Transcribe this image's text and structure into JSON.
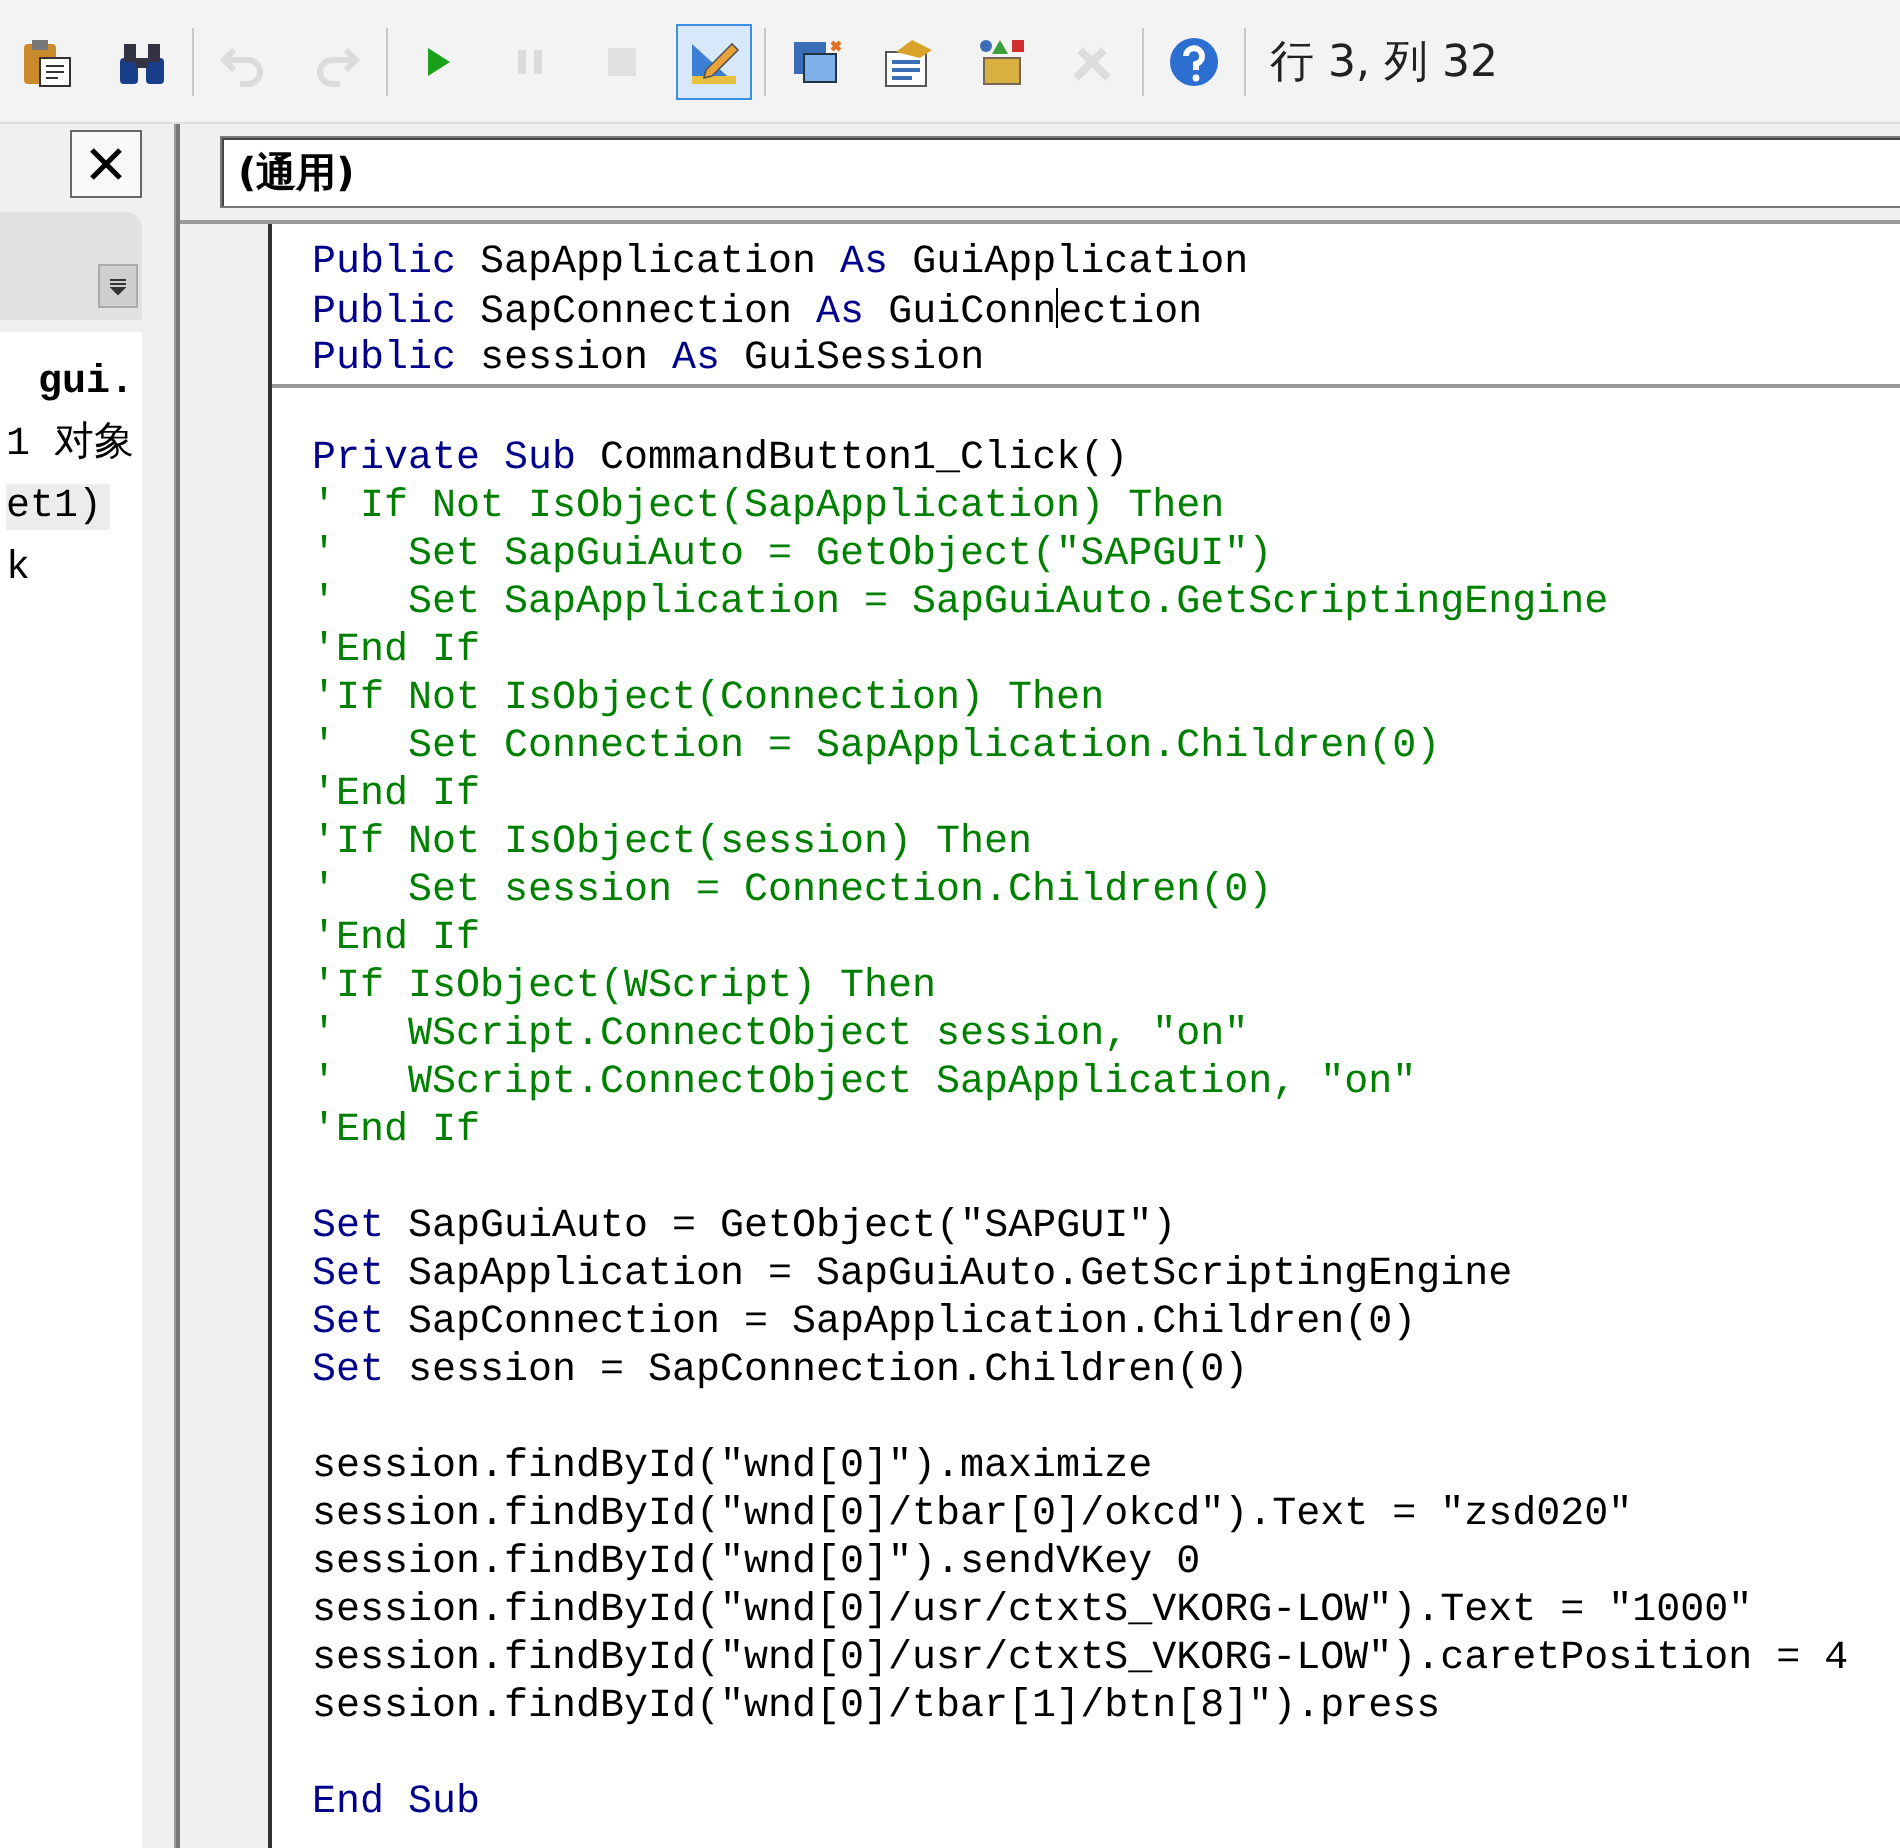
{
  "toolbar": {
    "groups": [
      [
        {
          "disabled": false,
          "selected": false
        },
        {
          "disabled": false,
          "selected": false
        }
      ],
      [
        {
          "disabled": true,
          "selected": false
        },
        {
          "disabled": true,
          "selected": false
        }
      ],
      [
        {
          "disabled": false,
          "selected": false
        },
        {
          "disabled": true,
          "selected": false
        },
        {
          "disabled": true,
          "selected": false
        },
        {
          "disabled": false,
          "selected": true
        }
      ],
      [
        {
          "disabled": false,
          "selected": false
        },
        {
          "disabled": false,
          "selected": false
        },
        {
          "disabled": false,
          "selected": false
        },
        {
          "disabled": true,
          "selected": false
        }
      ],
      [
        {
          "disabled": false,
          "selected": false
        }
      ]
    ],
    "position": "行 3, 列 32"
  },
  "side_panel": {
    "items": [
      {
        "text": "gui.",
        "kind": "header",
        "selected": false
      },
      {
        "text": "1 对象",
        "kind": "item",
        "selected": false
      },
      {
        "text": "et1)",
        "kind": "item",
        "selected": true
      },
      {
        "text": "k",
        "kind": "item",
        "selected": false
      }
    ]
  },
  "editor": {
    "object_combo": "(通用)",
    "sections": [
      {
        "blocks": [
          [
            [
              {
                "kind": "keyword",
                "text": "Public "
              },
              {
                "kind": "plain",
                "text": "SapApplication "
              },
              {
                "kind": "keyword",
                "text": "As "
              },
              {
                "kind": "plain",
                "text": "GuiApplication"
              }
            ],
            [
              {
                "kind": "keyword",
                "text": "Public "
              },
              {
                "kind": "plain",
                "text": "SapConnection "
              },
              {
                "kind": "keyword",
                "text": "As "
              },
              {
                "kind": "plain",
                "text": "GuiConn"
              },
              {
                "kind": "caret"
              },
              {
                "kind": "plain",
                "text": "ection"
              }
            ],
            [
              {
                "kind": "keyword",
                "text": "Public "
              },
              {
                "kind": "plain",
                "text": "session "
              },
              {
                "kind": "keyword",
                "text": "As "
              },
              {
                "kind": "plain",
                "text": "GuiSession"
              }
            ]
          ]
        ]
      },
      {
        "blocks": [
          [
            [
              {
                "kind": "keyword",
                "text": "Private Sub "
              },
              {
                "kind": "plain",
                "text": "CommandButton1_Click()"
              }
            ],
            [
              {
                "kind": "comment",
                "text": "' If Not IsObject(SapApplication) Then"
              }
            ],
            [
              {
                "kind": "comment",
                "text": "'   Set SapGuiAuto = GetObject(\"SAPGUI\")"
              }
            ],
            [
              {
                "kind": "comment",
                "text": "'   Set SapApplication = SapGuiAuto.GetScriptingEngine"
              }
            ],
            [
              {
                "kind": "comment",
                "text": "'End If"
              }
            ],
            [
              {
                "kind": "comment",
                "text": "'If Not IsObject(Connection) Then"
              }
            ],
            [
              {
                "kind": "comment",
                "text": "'   Set Connection = SapApplication.Children(0)"
              }
            ],
            [
              {
                "kind": "comment",
                "text": "'End If"
              }
            ],
            [
              {
                "kind": "comment",
                "text": "'If Not IsObject(session) Then"
              }
            ],
            [
              {
                "kind": "comment",
                "text": "'   Set session = Connection.Children(0)"
              }
            ],
            [
              {
                "kind": "comment",
                "text": "'End If"
              }
            ],
            [
              {
                "kind": "comment",
                "text": "'If IsObject(WScript) Then"
              }
            ],
            [
              {
                "kind": "comment",
                "text": "'   WScript.ConnectObject session, \"on\""
              }
            ],
            [
              {
                "kind": "comment",
                "text": "'   WScript.ConnectObject SapApplication, \"on\""
              }
            ],
            [
              {
                "kind": "comment",
                "text": "'End If"
              }
            ]
          ],
          [
            [
              {
                "kind": "keyword",
                "text": "Set "
              },
              {
                "kind": "plain",
                "text": "SapGuiAuto = GetObject(\"SAPGUI\")"
              }
            ],
            [
              {
                "kind": "keyword",
                "text": "Set "
              },
              {
                "kind": "plain",
                "text": "SapApplication = SapGuiAuto.GetScriptingEngine"
              }
            ],
            [
              {
                "kind": "keyword",
                "text": "Set "
              },
              {
                "kind": "plain",
                "text": "SapConnection = SapApplication.Children(0)"
              }
            ],
            [
              {
                "kind": "keyword",
                "text": "Set "
              },
              {
                "kind": "plain",
                "text": "session = SapConnection.Children(0)"
              }
            ]
          ],
          [
            [
              {
                "kind": "plain",
                "text": "session.findById(\"wnd[0]\").maximize"
              }
            ],
            [
              {
                "kind": "plain",
                "text": "session.findById(\"wnd[0]/tbar[0]/okcd\").Text = \"zsd020\""
              }
            ],
            [
              {
                "kind": "plain",
                "text": "session.findById(\"wnd[0]\").sendVKey 0"
              }
            ],
            [
              {
                "kind": "plain",
                "text": "session.findById(\"wnd[0]/usr/ctxtS_VKORG-LOW\").Text = \"1000\""
              }
            ],
            [
              {
                "kind": "plain",
                "text": "session.findById(\"wnd[0]/usr/ctxtS_VKORG-LOW\").caretPosition = 4"
              }
            ],
            [
              {
                "kind": "plain",
                "text": "session.findById(\"wnd[0]/tbar[1]/btn[8]\").press"
              }
            ]
          ],
          [
            [
              {
                "kind": "keyword",
                "text": "End Sub"
              }
            ]
          ]
        ]
      }
    ]
  }
}
